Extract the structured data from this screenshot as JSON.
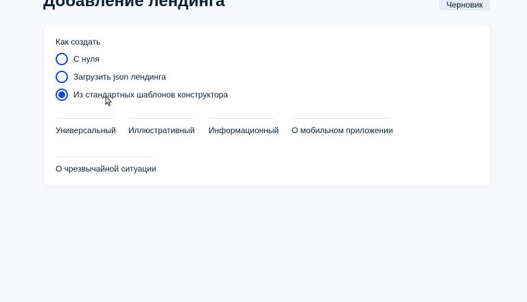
{
  "header": {
    "title": "Добавление лендинга",
    "status": "Черновик"
  },
  "form": {
    "section_label": "Как создать",
    "options": [
      {
        "label": "С нуля",
        "selected": false
      },
      {
        "label": "Загрузить json лендинга",
        "selected": false
      },
      {
        "label": "Из стандартных шаблонов конструктора",
        "selected": true
      }
    ],
    "templates": [
      {
        "label": "Универсальный"
      },
      {
        "label": "Иллюстративный"
      },
      {
        "label": "Информационный"
      },
      {
        "label": "О мобильном приложении"
      },
      {
        "label": "О чрезвычайной ситуации"
      }
    ]
  },
  "colors": {
    "accent": "#0d4cd3",
    "background": "#f7f9fc",
    "text": "#0b1f33"
  },
  "icons": {
    "pointer": "mouse-pointer-icon"
  }
}
